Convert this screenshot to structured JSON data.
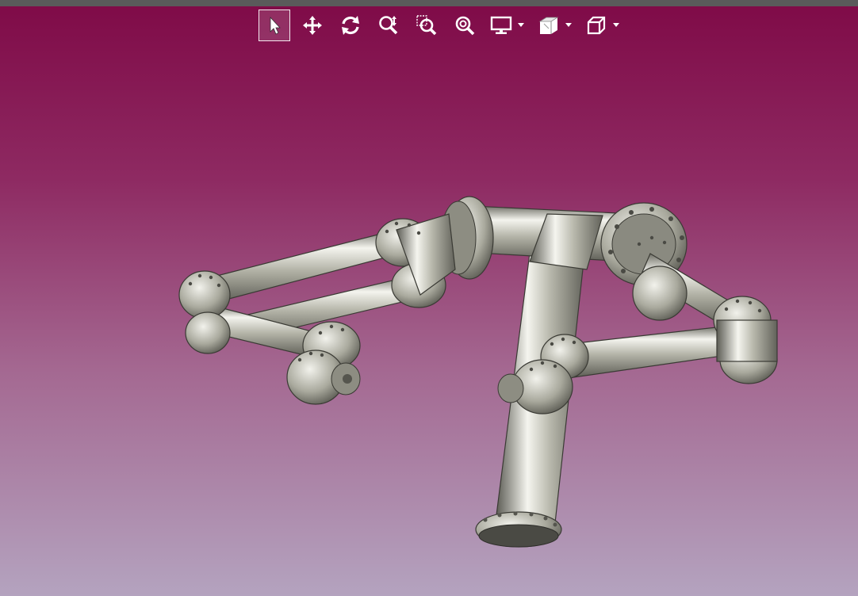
{
  "window": {
    "titlebar_color": "#5a5a5a"
  },
  "toolbar": {
    "icon_color": "#ffffff",
    "buttons": [
      {
        "icon": "select-arrow-icon",
        "active": true
      },
      {
        "icon": "pan-move-icon",
        "active": false
      },
      {
        "icon": "rotate-icon",
        "active": false
      },
      {
        "icon": "zoom-dynamic-icon",
        "active": false
      },
      {
        "icon": "zoom-window-icon",
        "active": false
      },
      {
        "icon": "zoom-fit-icon",
        "active": false
      },
      {
        "icon": "display-mode-icon",
        "has_dropdown": true
      },
      {
        "icon": "section-plane-icon",
        "has_dropdown": true
      },
      {
        "icon": "standard-view-cube-icon",
        "has_dropdown": true
      }
    ]
  },
  "viewport": {
    "background_top": "#7f0a47",
    "background_bottom": "#b4a3bf",
    "model": "pipe-assembly",
    "model_color": "#b8b8ad"
  }
}
